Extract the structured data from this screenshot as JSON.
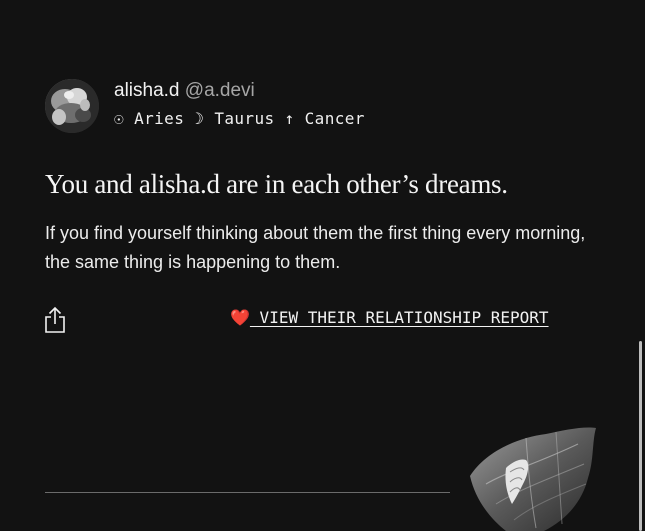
{
  "profile": {
    "username": "alisha.d",
    "handle": "@a.devi",
    "signs_line": "☉ Aries ☽ Taurus ↑ Cancer"
  },
  "match": {
    "headline": "You and alisha.d are in each other’s dreams.",
    "description": "If you find yourself thinking about them the first thing every morning, the same thing is happening to them."
  },
  "actions": {
    "share_icon": "share-icon",
    "heart_emoji": "❤️",
    "report_link": " VIEW THEIR RELATIONSHIP REPORT"
  },
  "colors": {
    "background": "#121212",
    "text": "#f2f2f2",
    "muted": "#a6a6a6",
    "heart": "#e0262e"
  }
}
